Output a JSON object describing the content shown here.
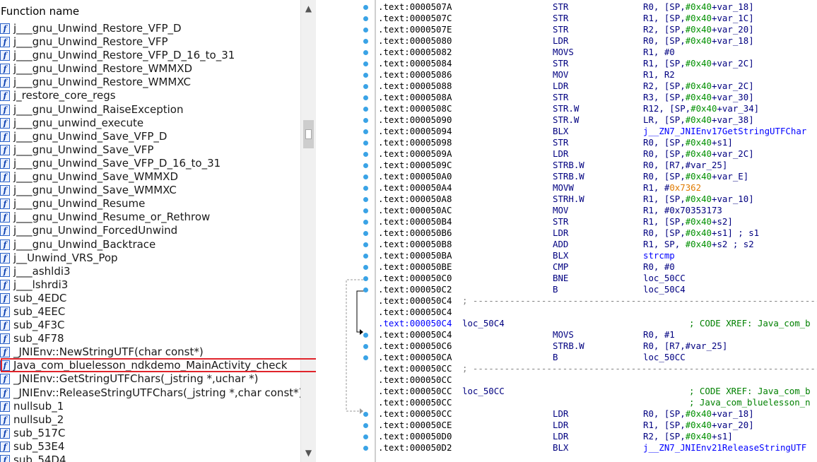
{
  "func_pane": {
    "header": "Function name",
    "icon_glyph": "f",
    "functions": [
      "j___gnu_Unwind_Restore_VFP_D",
      "j___gnu_Unwind_Restore_VFP",
      "j___gnu_Unwind_Restore_VFP_D_16_to_31",
      "j___gnu_Unwind_Restore_WMMXD",
      "j___gnu_Unwind_Restore_WMMXC",
      "j_restore_core_regs",
      "j___gnu_Unwind_RaiseException",
      "j___gnu_unwind_execute",
      "j___gnu_Unwind_Save_VFP_D",
      "j___gnu_Unwind_Save_VFP",
      "j___gnu_Unwind_Save_VFP_D_16_to_31",
      "j___gnu_Unwind_Save_WMMXD",
      "j___gnu_Unwind_Save_WMMXC",
      "j___gnu_Unwind_Resume",
      "j___gnu_Unwind_Resume_or_Rethrow",
      "j___gnu_Unwind_ForcedUnwind",
      "j___gnu_Unwind_Backtrace",
      "j__Unwind_VRS_Pop",
      "j___ashldi3",
      "j___lshrdi3",
      "sub_4EDC",
      "sub_4EEC",
      "sub_4F3C",
      "sub_4F78",
      "_JNIEnv::NewStringUTF(char const*)",
      "Java_com_bluelesson_ndkdemo_MainActivity_check",
      "_JNIEnv::GetStringUTFChars(_jstring *,uchar *)",
      "_JNIEnv::ReleaseStringUTFChars(_jstring *,char const*)",
      "nullsub_1",
      "nullsub_2",
      "sub_517C",
      "sub_53E4",
      "sub_54D4"
    ],
    "highlighted": "Java_com_bluelesson_ndkdemo_MainActivity_check",
    "highlight_color": "#e0242b",
    "scroll_up_glyph": "▲",
    "scroll_down_glyph": "▼"
  },
  "disasm": {
    "lines": [
      {
        "kind": "ins",
        "addr": ".text:0000507A",
        "mnem": "STR",
        "ops": [
          {
            "t": "R0, [SP,"
          },
          {
            "t": "#0x40",
            "c": "num"
          },
          {
            "t": "+var_18]"
          }
        ]
      },
      {
        "kind": "ins",
        "addr": ".text:0000507C",
        "mnem": "STR",
        "ops": [
          {
            "t": "R1, [SP,"
          },
          {
            "t": "#0x40",
            "c": "num"
          },
          {
            "t": "+var_1C]"
          }
        ]
      },
      {
        "kind": "ins",
        "addr": ".text:0000507E",
        "mnem": "STR",
        "ops": [
          {
            "t": "R2, [SP,"
          },
          {
            "t": "#0x40",
            "c": "num"
          },
          {
            "t": "+var_20]"
          }
        ]
      },
      {
        "kind": "ins",
        "addr": ".text:00005080",
        "mnem": "LDR",
        "ops": [
          {
            "t": "R0, [SP,"
          },
          {
            "t": "#0x40",
            "c": "num"
          },
          {
            "t": "+var_18]"
          }
        ]
      },
      {
        "kind": "ins",
        "addr": ".text:00005082",
        "mnem": "MOVS",
        "ops": [
          {
            "t": "R1, #0"
          }
        ]
      },
      {
        "kind": "ins",
        "addr": ".text:00005084",
        "mnem": "STR",
        "ops": [
          {
            "t": "R1, [SP,"
          },
          {
            "t": "#0x40",
            "c": "num"
          },
          {
            "t": "+var_2C]"
          }
        ]
      },
      {
        "kind": "ins",
        "addr": ".text:00005086",
        "mnem": "MOV",
        "ops": [
          {
            "t": "R1, R2"
          }
        ]
      },
      {
        "kind": "ins",
        "addr": ".text:00005088",
        "mnem": "LDR",
        "ops": [
          {
            "t": "R2, [SP,"
          },
          {
            "t": "#0x40",
            "c": "num"
          },
          {
            "t": "+var_2C]"
          }
        ]
      },
      {
        "kind": "ins",
        "addr": ".text:0000508A",
        "mnem": "STR",
        "ops": [
          {
            "t": "R3, [SP,"
          },
          {
            "t": "#0x40",
            "c": "num"
          },
          {
            "t": "+var_30]"
          }
        ]
      },
      {
        "kind": "ins",
        "addr": ".text:0000508C",
        "mnem": "STR.W",
        "ops": [
          {
            "t": "R12, [SP,"
          },
          {
            "t": "#0x40",
            "c": "num"
          },
          {
            "t": "+var_34]"
          }
        ]
      },
      {
        "kind": "ins",
        "addr": ".text:00005090",
        "mnem": "STR.W",
        "ops": [
          {
            "t": "LR, [SP,"
          },
          {
            "t": "#0x40",
            "c": "num"
          },
          {
            "t": "+var_38]"
          }
        ]
      },
      {
        "kind": "ins",
        "addr": ".text:00005094",
        "mnem": "BLX",
        "ops": [
          {
            "t": "j__ZN7_JNIEnv17GetStringUTFChar",
            "c": "sym"
          }
        ]
      },
      {
        "kind": "ins",
        "addr": ".text:00005098",
        "mnem": "STR",
        "ops": [
          {
            "t": "R0, [SP,"
          },
          {
            "t": "#0x40",
            "c": "num"
          },
          {
            "t": "+s1]"
          }
        ]
      },
      {
        "kind": "ins",
        "addr": ".text:0000509A",
        "mnem": "LDR",
        "ops": [
          {
            "t": "R0, [SP,"
          },
          {
            "t": "#0x40",
            "c": "num"
          },
          {
            "t": "+var_2C]"
          }
        ]
      },
      {
        "kind": "ins",
        "addr": ".text:0000509C",
        "mnem": "STRB.W",
        "ops": [
          {
            "t": "R0, [R7,#var_25]"
          }
        ]
      },
      {
        "kind": "ins",
        "addr": ".text:000050A0",
        "mnem": "STRB.W",
        "ops": [
          {
            "t": "R0, [SP,"
          },
          {
            "t": "#0x40",
            "c": "num"
          },
          {
            "t": "+var_E]"
          }
        ]
      },
      {
        "kind": "ins",
        "addr": ".text:000050A4",
        "mnem": "MOVW",
        "ops": [
          {
            "t": "R1, #"
          },
          {
            "t": "0x7362",
            "c": "hex"
          }
        ]
      },
      {
        "kind": "ins",
        "addr": ".text:000050A8",
        "mnem": "STRH.W",
        "ops": [
          {
            "t": "R1, [SP,"
          },
          {
            "t": "#0x40",
            "c": "num"
          },
          {
            "t": "+var_10]"
          }
        ]
      },
      {
        "kind": "ins",
        "addr": ".text:000050AC",
        "mnem": "MOV",
        "ops": [
          {
            "t": "R1, #0x70353173"
          }
        ]
      },
      {
        "kind": "ins",
        "addr": ".text:000050B4",
        "mnem": "STR",
        "ops": [
          {
            "t": "R1, [SP,"
          },
          {
            "t": "#0x40",
            "c": "num"
          },
          {
            "t": "+s2]"
          }
        ]
      },
      {
        "kind": "ins",
        "addr": ".text:000050B6",
        "mnem": "LDR",
        "ops": [
          {
            "t": "R0, [SP,"
          },
          {
            "t": "#0x40",
            "c": "num"
          },
          {
            "t": "+s1] ; s1"
          }
        ]
      },
      {
        "kind": "ins",
        "addr": ".text:000050B8",
        "mnem": "ADD",
        "ops": [
          {
            "t": "R1, SP, "
          },
          {
            "t": "#0x40",
            "c": "num"
          },
          {
            "t": "+s2 ; s2"
          }
        ]
      },
      {
        "kind": "ins",
        "addr": ".text:000050BA",
        "mnem": "BLX",
        "ops": [
          {
            "t": "strcmp",
            "c": "sym"
          }
        ]
      },
      {
        "kind": "ins",
        "addr": ".text:000050BE",
        "mnem": "CMP",
        "ops": [
          {
            "t": "R0, #0"
          }
        ]
      },
      {
        "kind": "ins",
        "addr": ".text:000050C0",
        "mnem": "BNE",
        "ops": [
          {
            "t": "loc_50CC"
          }
        ]
      },
      {
        "kind": "ins",
        "addr": ".text:000050C2",
        "mnem": "B",
        "ops": [
          {
            "t": "loc_50C4"
          }
        ]
      },
      {
        "kind": "sep",
        "addr": ".text:000050C4",
        "text": "; ---------------------------------------------------------------------------"
      },
      {
        "kind": "blank",
        "addr": ".text:000050C4"
      },
      {
        "kind": "label",
        "addr": ".text:000050C4",
        "hl": true,
        "label": "loc_50C4",
        "comment": "; CODE XREF: Java_com_b"
      },
      {
        "kind": "ins",
        "addr": ".text:000050C4",
        "mnem": "MOVS",
        "ops": [
          {
            "t": "R0, #1"
          }
        ]
      },
      {
        "kind": "ins",
        "addr": ".text:000050C6",
        "mnem": "STRB.W",
        "ops": [
          {
            "t": "R0, [R7,#var_25]"
          }
        ]
      },
      {
        "kind": "ins",
        "addr": ".text:000050CA",
        "mnem": "B",
        "ops": [
          {
            "t": "loc_50CC"
          }
        ]
      },
      {
        "kind": "sep",
        "addr": ".text:000050CC",
        "text": "; ---------------------------------------------------------------------------"
      },
      {
        "kind": "blank",
        "addr": ".text:000050CC"
      },
      {
        "kind": "label",
        "addr": ".text:000050CC",
        "label": "loc_50CC",
        "comment": "; CODE XREF: Java_com_b"
      },
      {
        "kind": "label",
        "addr": ".text:000050CC",
        "label": "",
        "comment": "; Java_com_bluelesson_n"
      },
      {
        "kind": "ins",
        "addr": ".text:000050CC",
        "mnem": "LDR",
        "ops": [
          {
            "t": "R0, [SP,"
          },
          {
            "t": "#0x40",
            "c": "num"
          },
          {
            "t": "+var_18]"
          }
        ]
      },
      {
        "kind": "ins",
        "addr": ".text:000050CE",
        "mnem": "LDR",
        "ops": [
          {
            "t": "R1, [SP,"
          },
          {
            "t": "#0x40",
            "c": "num"
          },
          {
            "t": "+var_20]"
          }
        ]
      },
      {
        "kind": "ins",
        "addr": ".text:000050D0",
        "mnem": "LDR",
        "ops": [
          {
            "t": "R2, [SP,"
          },
          {
            "t": "#0x40",
            "c": "num"
          },
          {
            "t": "+s1]"
          }
        ]
      },
      {
        "kind": "ins",
        "addr": ".text:000050D2",
        "mnem": "BLX",
        "ops": [
          {
            "t": "j__ZN7_JNIEnv21ReleaseStringUTF",
            "c": "sym"
          }
        ]
      }
    ]
  },
  "colors": {
    "address": "#000000",
    "address_highlight": "#0000ff",
    "mnemonic": "#000080",
    "number": "#009000",
    "immediate_hex": "#e07a00",
    "symbol": "#0000ff",
    "comment": "#008000",
    "breakpoint_dot": "#3aa3e6"
  }
}
